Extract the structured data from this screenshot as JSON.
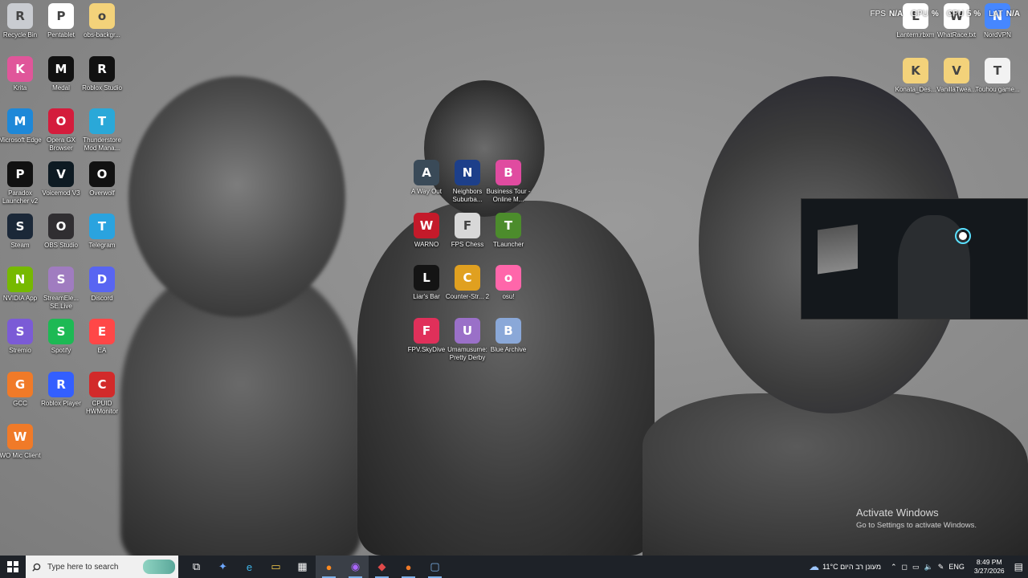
{
  "overlay": {
    "fps_label": "FPS",
    "fps_value": "N/A",
    "gpu_label": "GPU",
    "gpu_value": "%",
    "cpu_label": "CPU",
    "cpu_value": "5 %",
    "lat_label": "LAT",
    "lat_value": "N/A"
  },
  "desktop_icons_left": [
    {
      "label": "Recycle Bin",
      "icon": "recycle-bin-icon",
      "color": "#c9ccd1"
    },
    {
      "label": "Pentablet",
      "icon": "pentablet-icon",
      "color": "#ffffff"
    },
    {
      "label": "obs-backgr...",
      "icon": "folder-icon",
      "color": "#f3d27a"
    },
    {
      "label": "Krita",
      "icon": "krita-icon",
      "color": "#e0569a"
    },
    {
      "label": "Medal",
      "icon": "medal-icon",
      "color": "#111111"
    },
    {
      "label": "Roblox Studio",
      "icon": "roblox-studio-icon",
      "color": "#111111"
    },
    {
      "label": "Microsoft Edge",
      "icon": "edge-icon",
      "color": "#1e88d8"
    },
    {
      "label": "Opera GX Browser",
      "icon": "opera-gx-icon",
      "color": "#d41c3c"
    },
    {
      "label": "Thunderstore Mod Mana...",
      "icon": "thunderstore-icon",
      "color": "#2aa8d8"
    },
    {
      "label": "Paradox Launcher v2",
      "icon": "paradox-icon",
      "color": "#111111"
    },
    {
      "label": "Voicemod V3",
      "icon": "voicemod-icon",
      "color": "#0d1a22"
    },
    {
      "label": "Overwolf",
      "icon": "overwolf-icon",
      "color": "#111111"
    },
    {
      "label": "Steam",
      "icon": "steam-icon",
      "color": "#1b2838"
    },
    {
      "label": "OBS Studio",
      "icon": "obs-icon",
      "color": "#302e31"
    },
    {
      "label": "Telegram",
      "icon": "telegram-icon",
      "color": "#2aa3df"
    },
    {
      "label": "NVIDIA App",
      "icon": "nvidia-icon",
      "color": "#76b900"
    },
    {
      "label": "StreamEle... SE.Live",
      "icon": "streamelements-icon",
      "color": "#a07cc0"
    },
    {
      "label": "Discord",
      "icon": "discord-icon",
      "color": "#5865f2"
    },
    {
      "label": "Stremio",
      "icon": "stremio-icon",
      "color": "#7b5bd6"
    },
    {
      "label": "Spotify",
      "icon": "spotify-icon",
      "color": "#1db954"
    },
    {
      "label": "EA",
      "icon": "ea-icon",
      "color": "#ff4747"
    },
    {
      "label": "GCC",
      "icon": "gcc-icon",
      "color": "#f07a28"
    },
    {
      "label": "Roblox Player",
      "icon": "roblox-player-icon",
      "color": "#335fff"
    },
    {
      "label": "CPUID HWMonitor",
      "icon": "hwmonitor-icon",
      "color": "#d22a2a"
    },
    {
      "label": "WO Mic Client",
      "icon": "microphone-icon",
      "color": "#f07a28"
    }
  ],
  "desktop_icons_center": [
    {
      "label": "A Way Out",
      "icon": "a-way-out-icon",
      "color": "#3a4a58"
    },
    {
      "label": "Neighbors Suburba...",
      "icon": "neighbors-icon",
      "color": "#1d3f8a"
    },
    {
      "label": "Business Tour - Online M...",
      "icon": "business-tour-icon",
      "color": "#e04ba0"
    },
    {
      "label": "WARNO",
      "icon": "warno-icon",
      "color": "#c41a2a"
    },
    {
      "label": "FPS Chess",
      "icon": "chess-icon",
      "color": "#d8d8d8"
    },
    {
      "label": "TLauncher",
      "icon": "tlauncher-icon",
      "color": "#4c8c2c"
    },
    {
      "label": "Liar's Bar",
      "icon": "liars-bar-icon",
      "color": "#141414"
    },
    {
      "label": "Counter-Str... 2",
      "icon": "counter-strike-icon",
      "color": "#e0a020"
    },
    {
      "label": "osu!",
      "icon": "osu-icon",
      "color": "#ff66aa"
    },
    {
      "label": "FPV.SkyDive",
      "icon": "skydive-icon",
      "color": "#e0305a"
    },
    {
      "label": "Umamusume: Pretty Derby",
      "icon": "umamusume-icon",
      "color": "#9a70c8"
    },
    {
      "label": "Blue Archive",
      "icon": "blue-archive-icon",
      "color": "#8aa8d8"
    }
  ],
  "desktop_icons_right": [
    {
      "label": "Lantern.rbxm",
      "icon": "file-icon",
      "color": "#ffffff"
    },
    {
      "label": "WhatRace.txt",
      "icon": "text-file-icon",
      "color": "#ffffff"
    },
    {
      "label": "NordVPN",
      "icon": "nordvpn-icon",
      "color": "#4687ff"
    },
    {
      "label": "Konata_Des...",
      "icon": "folder-icon",
      "color": "#f3d27a"
    },
    {
      "label": "VanillaTwea...",
      "icon": "folder-icon",
      "color": "#f3d27a"
    },
    {
      "label": "Touhou game...",
      "icon": "file-icon",
      "color": "#f2f2f2"
    }
  ],
  "activation": {
    "title": "Activate Windows",
    "subtitle": "Go to Settings to activate Windows."
  },
  "taskbar": {
    "search_placeholder": "Type here to search",
    "apps": [
      {
        "name": "task-view-icon",
        "glyph": "⧉",
        "color": "#ffffff"
      },
      {
        "name": "copilot-icon",
        "glyph": "✦",
        "color": "#6ea8ff"
      },
      {
        "name": "edge-taskbar-icon",
        "glyph": "e",
        "color": "#3fb6ea"
      },
      {
        "name": "file-explorer-icon",
        "glyph": "▭",
        "color": "#f3c94a"
      },
      {
        "name": "store-icon",
        "glyph": "▦",
        "color": "#ffffff"
      },
      {
        "name": "firefox-icon",
        "glyph": "●",
        "color": "#ff8a1f"
      },
      {
        "name": "chrome-obs-icon",
        "glyph": "◉",
        "color": "#aa66ff"
      },
      {
        "name": "paint-icon",
        "glyph": "◆",
        "color": "#e04a4a"
      },
      {
        "name": "mic-taskbar-icon",
        "glyph": "●",
        "color": "#f07a28"
      },
      {
        "name": "window-app-icon",
        "glyph": "▢",
        "color": "#7db1e8"
      }
    ],
    "weather": "11°C  מעונן רב היום",
    "language": "ENG",
    "time": "8:49 PM",
    "date": "3/27/2026"
  }
}
